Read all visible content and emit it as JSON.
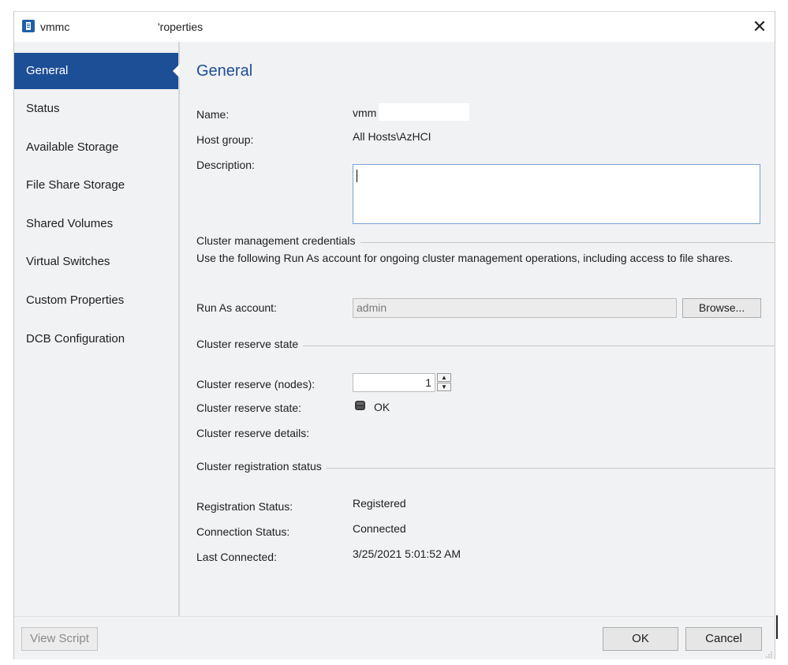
{
  "window": {
    "title_left": "vmmc",
    "title_right": "'roperties",
    "close_glyph": "✕"
  },
  "sidebar": {
    "items": [
      {
        "label": "General",
        "selected": true
      },
      {
        "label": "Status"
      },
      {
        "label": "Available Storage"
      },
      {
        "label": "File Share Storage"
      },
      {
        "label": "Shared Volumes"
      },
      {
        "label": "Virtual Switches"
      },
      {
        "label": "Custom Properties"
      },
      {
        "label": "DCB Configuration"
      }
    ]
  },
  "general": {
    "heading": "General",
    "name_label": "Name:",
    "name_value": "vmm",
    "host_group_label": "Host group:",
    "host_group_value": "All Hosts\\AzHCI",
    "description_label": "Description:",
    "description_value": ""
  },
  "credentials": {
    "section_title": "Cluster management credentials",
    "description": "Use the following Run As account for ongoing cluster management operations, including access to file shares.",
    "runas_label": "Run As account:",
    "runas_value": "admin",
    "browse_label": "Browse..."
  },
  "reserve": {
    "section_title": "Cluster reserve state",
    "nodes_label": "Cluster reserve (nodes):",
    "nodes_value": "1",
    "state_label": "Cluster reserve state:",
    "state_value": "OK",
    "details_label": "Cluster reserve details:"
  },
  "registration": {
    "section_title": "Cluster registration status",
    "status_label": "Registration Status:",
    "status_value": "Registered",
    "connection_label": "Connection Status:",
    "connection_value": "Connected",
    "last_connected_label": "Last Connected:",
    "last_connected_value": "3/25/2021 5:01:52 AM"
  },
  "footer": {
    "view_script_label": "View Script",
    "ok_label": "OK",
    "cancel_label": "Cancel"
  },
  "colors": {
    "accent": "#1d4f97",
    "panel_bg": "#f1f2f4"
  }
}
